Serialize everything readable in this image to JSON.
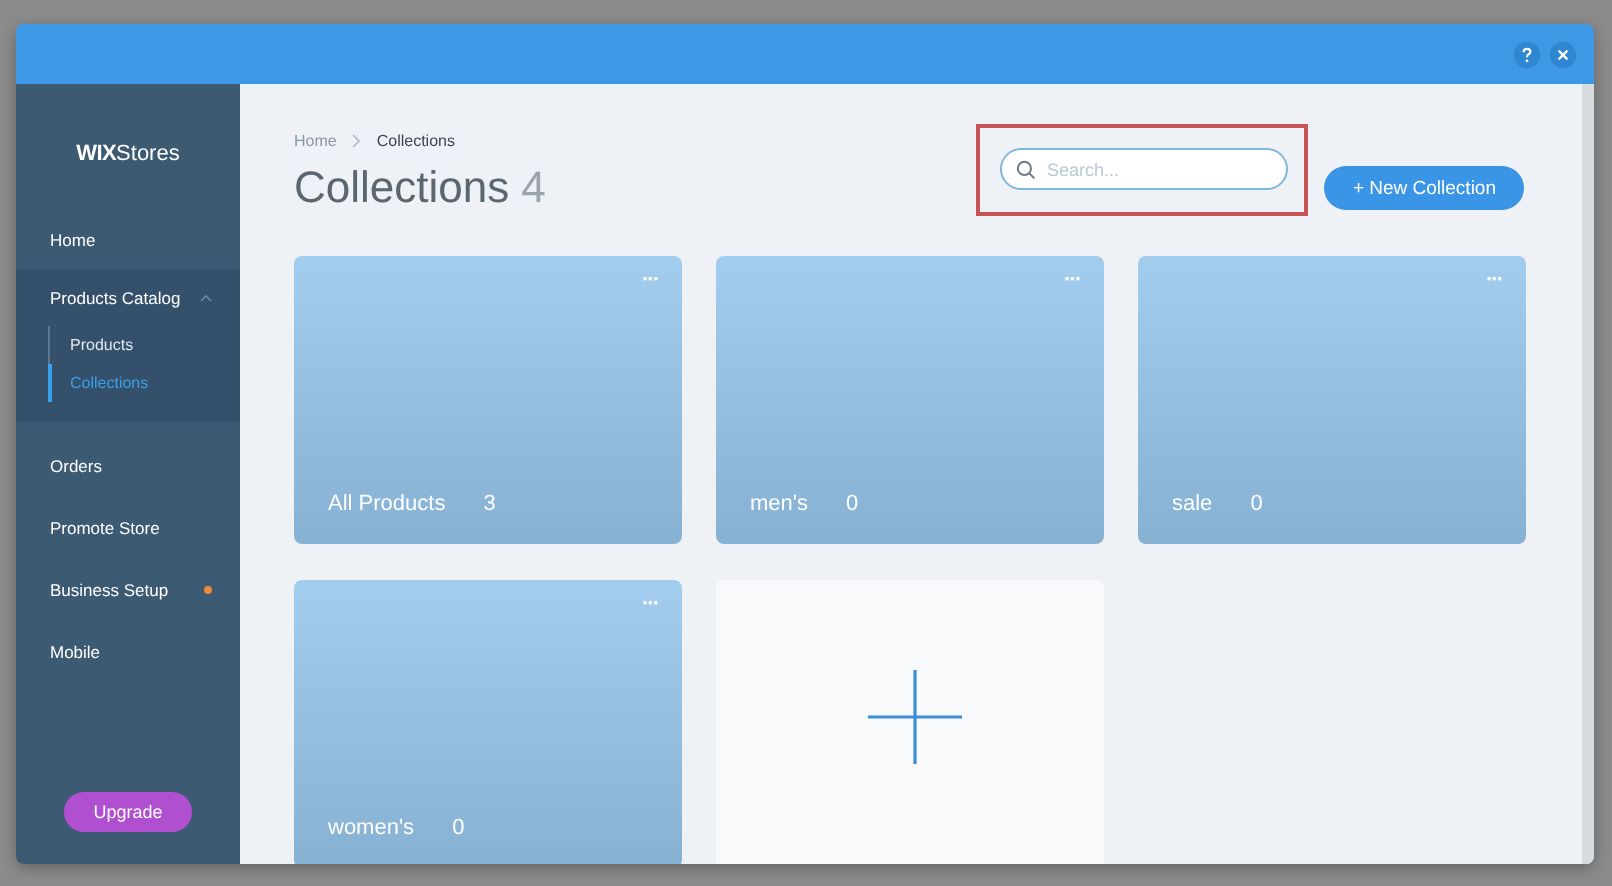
{
  "brand": {
    "logo_bold": "WIX",
    "logo_rest": "Stores"
  },
  "sidebar": {
    "items": [
      {
        "label": "Home",
        "selected": false,
        "notification": false
      },
      {
        "label": "Products Catalog",
        "selected": false,
        "notification": false,
        "expanded": true,
        "children": [
          {
            "label": "Products",
            "selected": false
          },
          {
            "label": "Collections",
            "selected": true
          }
        ]
      },
      {
        "label": "Orders",
        "selected": false,
        "notification": false
      },
      {
        "label": "Promote Store",
        "selected": false,
        "notification": false
      },
      {
        "label": "Business Setup",
        "selected": false,
        "notification": true
      },
      {
        "label": "Mobile",
        "selected": false,
        "notification": false
      }
    ],
    "upgrade_button": "Upgrade"
  },
  "breadcrumb": [
    "Home",
    "Collections"
  ],
  "page": {
    "title": "Collections",
    "count": "4"
  },
  "search": {
    "placeholder": "Search...",
    "highlighted": true
  },
  "new_button": "+ New Collection",
  "collections": [
    {
      "kind": "collection",
      "name": "All Products",
      "count": "3",
      "menu": "···"
    },
    {
      "kind": "collection",
      "name": "men's",
      "count": "0",
      "menu": "···"
    },
    {
      "kind": "collection",
      "name": "sale",
      "count": "0",
      "menu": "···"
    },
    {
      "kind": "collection",
      "name": "women's",
      "count": "0",
      "menu": "···"
    },
    {
      "kind": "add"
    }
  ]
}
